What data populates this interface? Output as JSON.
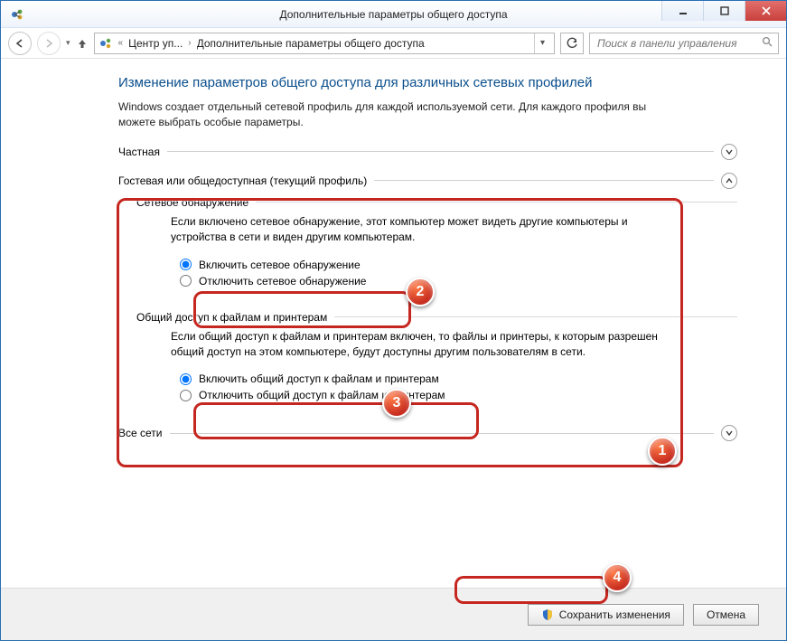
{
  "window": {
    "title": "Дополнительные параметры общего доступа"
  },
  "nav": {
    "crumb1": "Центр уп...",
    "crumb2": "Дополнительные параметры общего доступа",
    "search_placeholder": "Поиск в панели управления"
  },
  "page": {
    "heading": "Изменение параметров общего доступа для различных сетевых профилей",
    "description": "Windows создает отдельный сетевой профиль для каждой используемой сети. Для каждого профиля вы можете выбрать особые параметры."
  },
  "profiles": {
    "private": {
      "label": "Частная"
    },
    "guest": {
      "label": "Гостевая или общедоступная (текущий профиль)",
      "discovery": {
        "group_label": "Сетевое обнаружение",
        "description": "Если включено сетевое обнаружение, этот компьютер может видеть другие компьютеры и устройства в сети и виден другим компьютерам.",
        "option_on": "Включить сетевое обнаружение",
        "option_off": "Отключить сетевое обнаружение"
      },
      "sharing": {
        "group_label": "Общий доступ к файлам и принтерам",
        "description": "Если общий доступ к файлам и принтерам включен, то файлы и принтеры, к которым разрешен общий доступ на этом компьютере, будут доступны другим пользователям в сети.",
        "option_on": "Включить общий доступ к файлам и принтерам",
        "option_off": "Отключить общий доступ к файлам и принтерам"
      }
    },
    "all": {
      "label": "Все сети"
    }
  },
  "footer": {
    "save": "Сохранить изменения",
    "cancel": "Отмена"
  },
  "markers": {
    "m1": "1",
    "m2": "2",
    "m3": "3",
    "m4": "4"
  }
}
